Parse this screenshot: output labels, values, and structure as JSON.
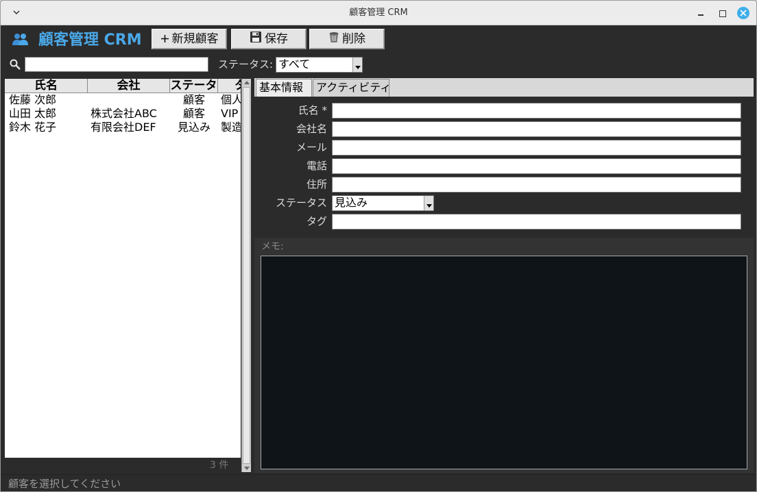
{
  "window": {
    "title": "顧客管理 CRM",
    "menu_icon": "chevron-down-icon"
  },
  "toolbar": {
    "app_title": "顧客管理 CRM",
    "app_icon": "people-icon",
    "new_label": "新規顧客",
    "save_label": "保存",
    "delete_label": "削除"
  },
  "search": {
    "value": "",
    "status_label": "ステータス:",
    "status_value": "すべて"
  },
  "table": {
    "columns": [
      "氏名",
      "会社",
      "ステータ",
      "タ"
    ],
    "rows": [
      {
        "name": "佐藤 次郎",
        "company": "",
        "status": "顧客",
        "tag": "個人"
      },
      {
        "name": "山田 太郎",
        "company": "株式会社ABC",
        "status": "顧客",
        "tag": "VIP"
      },
      {
        "name": "鈴木 花子",
        "company": "有限会社DEF",
        "status": "見込み",
        "tag": "製造"
      }
    ],
    "count": "3 件"
  },
  "tabs": {
    "basic": "基本情報",
    "activity": "アクティビティ"
  },
  "form": {
    "name_label": "氏名 *",
    "company_label": "会社名",
    "email_label": "メール",
    "phone_label": "電話",
    "address_label": "住所",
    "status_label": "ステータス",
    "status_value": "見込み",
    "tag_label": "タグ",
    "memo_label": "メモ:"
  },
  "statusbar": {
    "text": "顧客を選択してください"
  },
  "colors": {
    "accent": "#4aa8e8",
    "close": "#3daee9",
    "panel": "#2b2b2b"
  }
}
